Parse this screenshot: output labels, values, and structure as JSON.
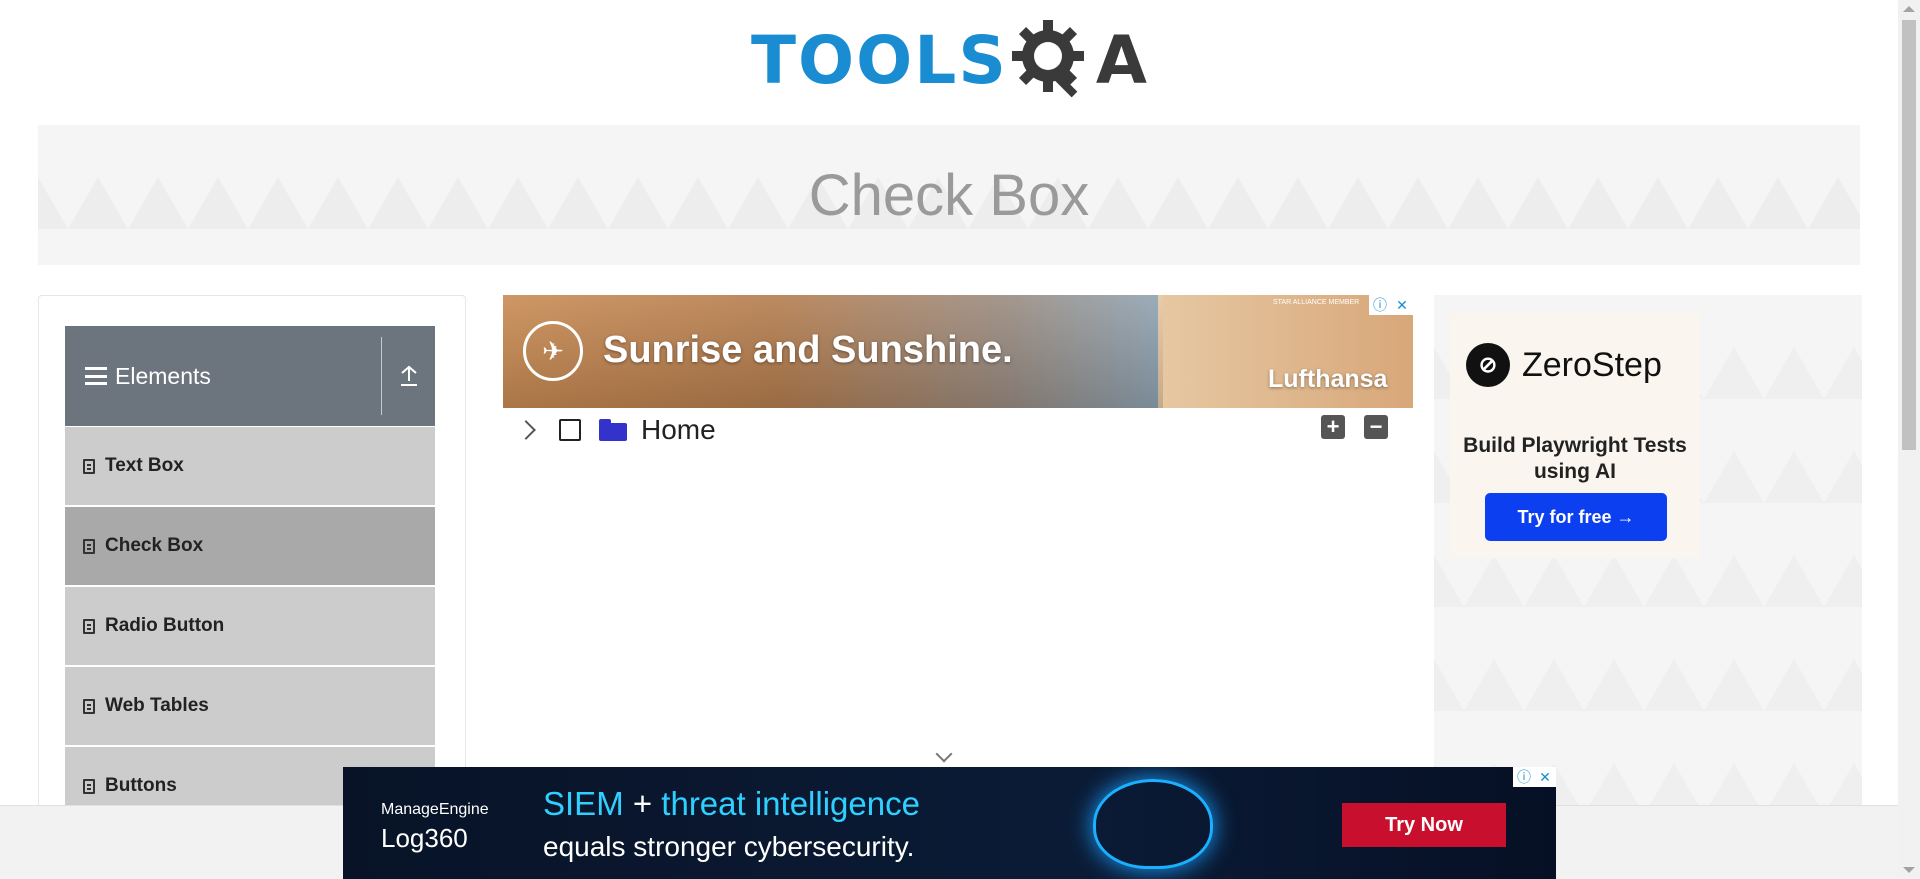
{
  "header": {
    "logo_main": "TOOLS",
    "logo_tail": "A"
  },
  "banner": {
    "title": "Check Box"
  },
  "sidebar": {
    "group_title": "Elements",
    "items": [
      {
        "label": "Text Box",
        "active": false
      },
      {
        "label": "Check Box",
        "active": true
      },
      {
        "label": "Radio Button",
        "active": false
      },
      {
        "label": "Web Tables",
        "active": false
      },
      {
        "label": "Buttons",
        "active": false
      }
    ]
  },
  "tree": {
    "root_label": "Home",
    "expand_all_symbol": "+",
    "collapse_all_symbol": "−"
  },
  "top_ad": {
    "headline": "Sunrise and Sunshine.",
    "brand": "Lufthansa",
    "mini_text": "STAR ALLIANCE MEMBER"
  },
  "right_ad": {
    "brand": "ZeroStep",
    "description": "Build Playwright Tests using AI",
    "cta": "Try for free →"
  },
  "bottom_ad": {
    "brand_top": "ManageEngine",
    "brand_bottom": "Log360",
    "headline_part1": "SIEM",
    "headline_plus": " + ",
    "headline_part2": "threat intelligence",
    "subline": "equals stronger cybersecurity.",
    "cta": "Try Now"
  },
  "colors": {
    "logo_blue": "#1a8dd2",
    "sidebar_header": "#6c757d",
    "menu_item": "#cccccc",
    "menu_item_active": "#a9a9a9",
    "folder_icon": "#3333cc",
    "zerostep_button": "#0b3ff0",
    "bottom_ad_cta": "#c8102e"
  }
}
